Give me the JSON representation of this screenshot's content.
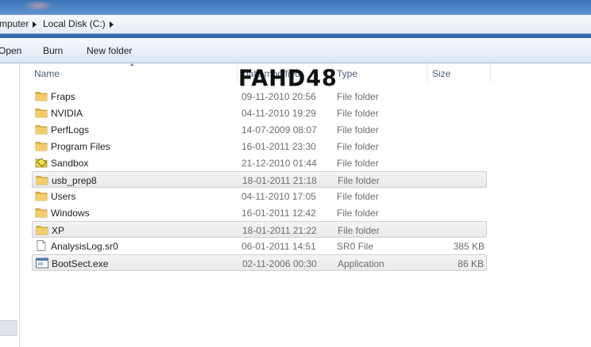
{
  "address_bar": {
    "crumbs": [
      "mputer",
      "Local Disk (C:)"
    ]
  },
  "toolbar": {
    "open_label": "Open",
    "burn_label": "Burn",
    "new_folder_label": "New folder"
  },
  "columns": {
    "name": "Name",
    "date": "Date modified",
    "type": "Type",
    "size": "Size"
  },
  "watermark": "FAHD48",
  "files": [
    {
      "name": "Fraps",
      "date": "09-11-2010 20:56",
      "type": "File folder",
      "size": "",
      "icon": "folder-icon",
      "selected": false
    },
    {
      "name": "NVIDIA",
      "date": "04-11-2010 19:29",
      "type": "File folder",
      "size": "",
      "icon": "folder-icon",
      "selected": false
    },
    {
      "name": "PerfLogs",
      "date": "14-07-2009 08:07",
      "type": "File folder",
      "size": "",
      "icon": "folder-icon",
      "selected": false
    },
    {
      "name": "Program Files",
      "date": "16-01-2011 23:30",
      "type": "File folder",
      "size": "",
      "icon": "folder-icon",
      "selected": false
    },
    {
      "name": "Sandbox",
      "date": "21-12-2010 01:44",
      "type": "File folder",
      "size": "",
      "icon": "sandbox-folder-icon",
      "selected": false
    },
    {
      "name": "usb_prep8",
      "date": "18-01-2011 21:18",
      "type": "File folder",
      "size": "",
      "icon": "folder-icon",
      "selected": true
    },
    {
      "name": "Users",
      "date": "04-11-2010 17:05",
      "type": "File folder",
      "size": "",
      "icon": "folder-icon",
      "selected": false
    },
    {
      "name": "Windows",
      "date": "16-01-2011 12:42",
      "type": "File folder",
      "size": "",
      "icon": "folder-icon",
      "selected": false
    },
    {
      "name": "XP",
      "date": "18-01-2011 21:22",
      "type": "File folder",
      "size": "",
      "icon": "folder-icon",
      "selected": true
    },
    {
      "name": "AnalysisLog.sr0",
      "date": "06-01-2011 14:51",
      "type": "SR0 File",
      "size": "385 KB",
      "icon": "document-icon",
      "selected": false
    },
    {
      "name": "BootSect.exe",
      "date": "02-11-2006 00:30",
      "type": "Application",
      "size": "86 KB",
      "icon": "application-icon",
      "selected": true
    }
  ]
}
